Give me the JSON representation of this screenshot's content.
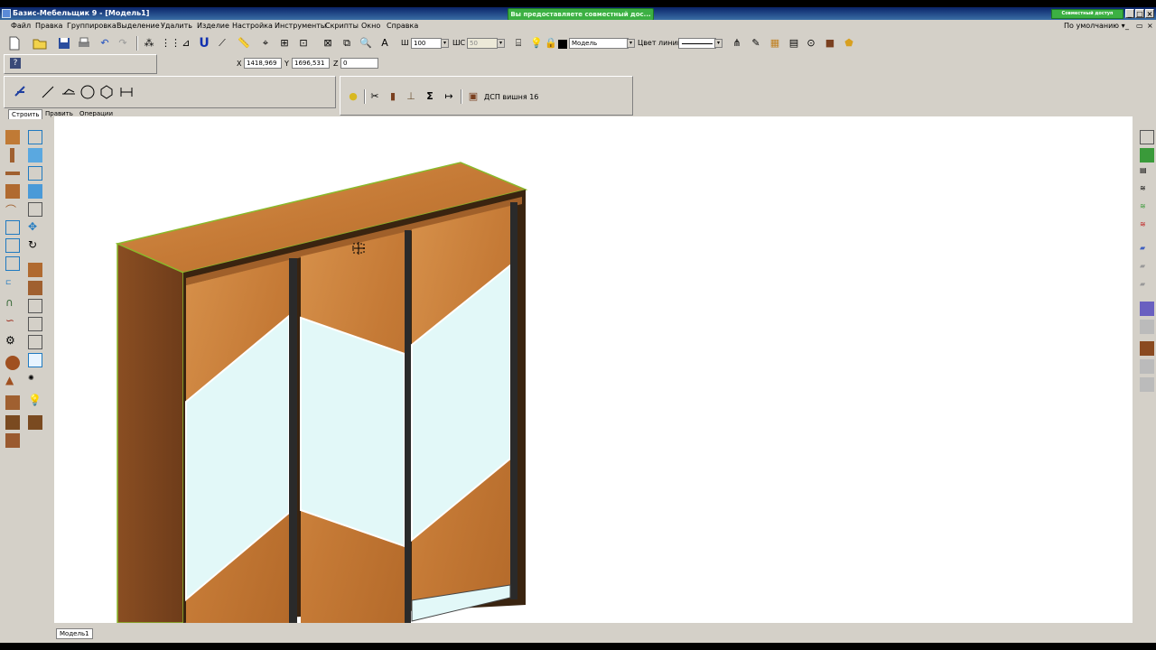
{
  "window": {
    "title": "Базис-Мебельщик 9 - [Модель1]",
    "notification": "Вы предоставляете совместный дос...",
    "share_button": "Совместный доступ разрешен",
    "min": "_",
    "max": "□",
    "close": "×"
  },
  "menu": {
    "items": [
      "Файл",
      "Правка",
      "Группировка",
      "Выделение",
      "Удалить",
      "Изделие",
      "Настройка",
      "Инструменты",
      "Скрипты",
      "Окно",
      "Справка"
    ],
    "default_label": "По умолчанию"
  },
  "toolbar": {
    "w_label": "Ш",
    "w_value": "100",
    "h_label": "ШС",
    "h_value": "50",
    "layer": "Модель",
    "line_color_label": "Цвет линии"
  },
  "coords": {
    "x_label": "X",
    "x_value": "1418,969",
    "y_label": "Y",
    "y_value": "1696,531",
    "z_label": "Z",
    "z_value": "0"
  },
  "tabs": [
    "Строить",
    "Править",
    "Операции"
  ],
  "material": "ДСП вишня 16",
  "model_tab": "Модель1",
  "colors": {
    "wood": "#c97a35",
    "wood_dark": "#7a4520",
    "mirror": "#e2f8f8",
    "edge": "#8ab82a",
    "frame": "#2e2e2e"
  },
  "icons": {
    "new": "new-doc-icon",
    "open": "open-folder-icon",
    "save": "save-icon",
    "print": "printer-icon",
    "undo": "undo-icon",
    "redo": "redo-icon",
    "magnet": "magnet-icon",
    "zoom": "zoom-icon",
    "sum": "sum-icon",
    "scissors": "scissors-icon",
    "bulb": "bulb-icon"
  }
}
